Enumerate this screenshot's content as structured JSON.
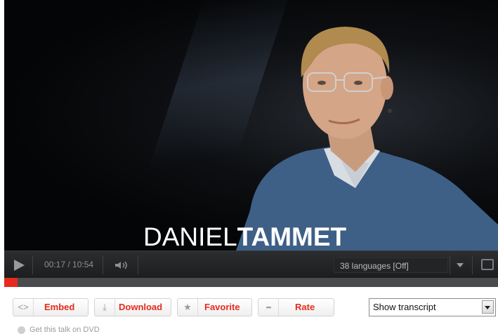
{
  "player": {
    "speaker_first": "DANIEL",
    "speaker_last": "TAMMET",
    "time": "00:17 / 10:54",
    "languages": "38 languages [Off]",
    "progress_fraction": 0.027
  },
  "actions": {
    "embed_label": "Embed",
    "download_label": "Download",
    "favorite_label": "Favorite",
    "rate_label": "Rate",
    "transcript_selected": "Show transcript",
    "dvd_link": "Get this talk on DVD"
  },
  "icons": {
    "play": "play-icon",
    "volume": "volume-icon",
    "fullscreen": "fullscreen-icon",
    "embed": "embed-icon",
    "download": "download-icon",
    "favorite": "star-icon",
    "rate": "rate-icon"
  },
  "colors": {
    "accent": "#e62b1e",
    "control_bar": "#1f2022",
    "progress_track": "#4a4b4d"
  }
}
